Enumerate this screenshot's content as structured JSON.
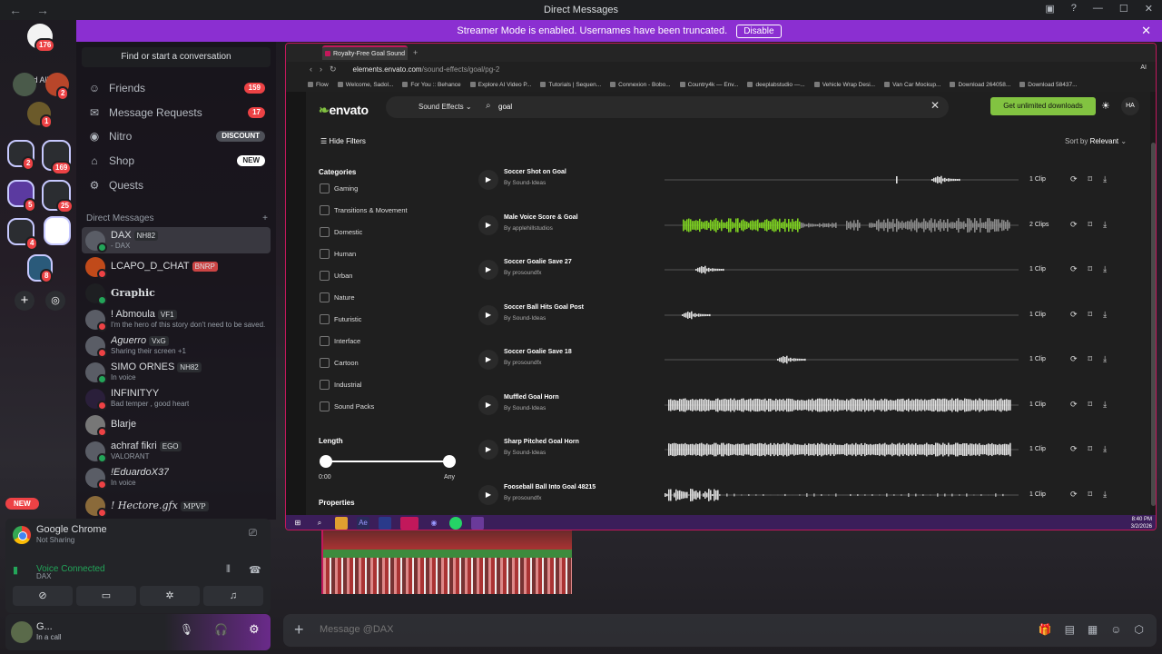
{
  "window": {
    "title": "Direct Messages"
  },
  "streamer_banner": {
    "text": "Streamer Mode is enabled. Usernames have been truncated.",
    "button": "Disable"
  },
  "rail": {
    "home_badge": "176",
    "read_all": "Read All",
    "badges": [
      "2",
      "1",
      "2",
      "169",
      "5",
      "25",
      "4",
      "8"
    ]
  },
  "sidebar": {
    "find": "Find or start a conversation",
    "nav": [
      {
        "label": "Friends",
        "count": "159",
        "icon": "friends-icon"
      },
      {
        "label": "Message Requests",
        "count": "17",
        "icon": "envelope-icon"
      },
      {
        "label": "Nitro",
        "tag": "DISCOUNT",
        "icon": "nitro-icon"
      },
      {
        "label": "Shop",
        "tag": "NEW",
        "icon": "shop-icon"
      },
      {
        "label": "Quests",
        "icon": "quests-icon"
      }
    ],
    "dm_header": "Direct Messages",
    "dms": [
      {
        "name": "DAX",
        "tag": "NH82",
        "sub": "- DAX",
        "status": "#23a559"
      },
      {
        "name": "LCAPO_D_CHAT",
        "tag": "BNRP",
        "sub": "",
        "status": "#ed4245"
      },
      {
        "name": "Graphic",
        "tag": "",
        "sub": "",
        "status": "#23a559"
      },
      {
        "name": "! Abmoula",
        "tag": "VF1",
        "sub": "I'm the hero of this story don't need to be saved.",
        "status": "#ed4245"
      },
      {
        "name": "Aguerro",
        "tag": "VxG",
        "sub": "Sharing their screen +1",
        "status": "#ed4245"
      },
      {
        "name": "SIMO ORNES",
        "tag": "NH82",
        "sub": "In voice",
        "status": "#23a559"
      },
      {
        "name": "INFINITYY",
        "tag": "",
        "sub": "Bad temper , good heart",
        "status": "#ed4245"
      },
      {
        "name": "Blarje",
        "tag": "",
        "sub": "",
        "status": "#ed4245"
      },
      {
        "name": "achraf fikri",
        "tag": "EGO",
        "sub": "VALORANT",
        "status": "#23a559"
      },
      {
        "name": "!EduardoX37",
        "tag": "",
        "sub": "In voice",
        "status": "#ed4245"
      },
      {
        "name": "! Hectore.gfx",
        "tag": "MPVP",
        "sub": "",
        "status": "#ed4245"
      }
    ],
    "new_pill": "NEW"
  },
  "share": {
    "app": "Google Chrome",
    "status": "Not Sharing",
    "voice_title": "Voice Connected",
    "voice_sub": "DAX"
  },
  "user": {
    "name": "G...",
    "status": "In a call"
  },
  "browser": {
    "tab_title": "Royalty-Free Goal Sound E",
    "url_host": "elements.envato.com",
    "url_path": "/sound-effects/goal/pg-2",
    "bookmarks": [
      "Flow",
      "Welcome, Sadol...",
      "For You :: Behance",
      "Explore AI Video P...",
      "Tutorials | Sequen...",
      "Connexion - Bobo...",
      "Country4k — Env...",
      "deeplabstudio —...",
      "Vehicle Wrap Desi...",
      "Van Car Mockup...",
      "Download 264058...",
      "Download 58437..."
    ],
    "ai_label": "AI"
  },
  "envato": {
    "logo": "envato",
    "category": "Sound Effects",
    "query": "goal",
    "cta": "Get unlimited downloads",
    "avatar": "HA",
    "hide_filters": "Hide Filters",
    "sort_label": "Sort by",
    "sort_value": "Relevant",
    "categories_heading": "Categories",
    "categories": [
      "Gaming",
      "Transitions & Movement",
      "Domestic",
      "Human",
      "Urban",
      "Nature",
      "Futuristic",
      "Interface",
      "Cartoon",
      "Industrial",
      "Sound Packs"
    ],
    "length_heading": "Length",
    "length_min": "0:00",
    "length_max": "Any",
    "properties_heading": "Properties",
    "tracks": [
      {
        "title": "Soccer Shot on Goal",
        "author": "By Sound-Ideas",
        "clips": "1 Clip",
        "wave": "spike2"
      },
      {
        "title": "Male Voice Score & Goal",
        "author": "By applehillstudios",
        "clips": "2 Clips",
        "wave": "voice"
      },
      {
        "title": "Soccer Goalie Save 27",
        "author": "By prosoundfx",
        "clips": "1 Clip",
        "wave": "spike1"
      },
      {
        "title": "Soccer Ball Hits Goal Post",
        "author": "By Sound-Ideas",
        "clips": "1 Clip",
        "wave": "spike0"
      },
      {
        "title": "Soccer Goalie Save 18",
        "author": "By prosoundfx",
        "clips": "1 Clip",
        "wave": "spike3"
      },
      {
        "title": "Muffled Goal Horn",
        "author": "By Sound-Ideas",
        "clips": "1 Clip",
        "wave": "full"
      },
      {
        "title": "Sharp Pitched Goal Horn",
        "author": "By Sound-Ideas",
        "clips": "1 Clip",
        "wave": "full2"
      },
      {
        "title": "Fooseball Ball Into Goal 48215",
        "author": "By prosoundfx",
        "clips": "1 Clip",
        "wave": "scatter"
      }
    ],
    "wave_played_color": "#7ed321",
    "wave_color": "#8a8a8a"
  },
  "taskbar": {
    "time": "8:40 PM",
    "date": "3/2/2026"
  },
  "message": {
    "placeholder": "Message @DAX"
  },
  "colors": {
    "accent": "#8b2fd1",
    "online": "#23a559",
    "danger": "#ed4245",
    "envato_green": "#82c341"
  }
}
